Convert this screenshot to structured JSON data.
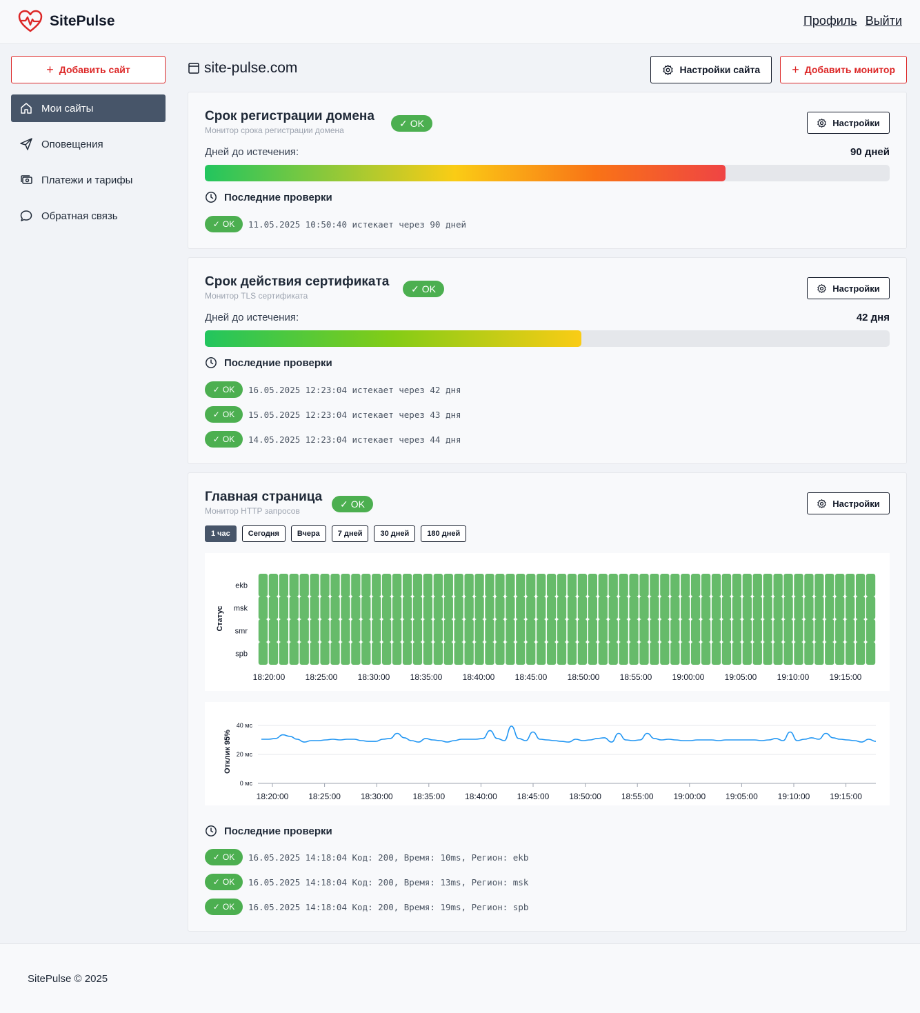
{
  "app": {
    "name": "SitePulse",
    "profile_link": "Профиль",
    "logout_link": "Выйти"
  },
  "colors": {
    "accent": "#dc2626",
    "ok": "#4caf50",
    "nav_active": "#475569",
    "line": "#2196f3"
  },
  "sidebar": {
    "add_site": "Добавить сайт",
    "items": [
      {
        "label": "Мои сайты",
        "icon": "home-icon",
        "active": true
      },
      {
        "label": "Оповещения",
        "icon": "send-icon"
      },
      {
        "label": "Платежи и тарифы",
        "icon": "payments-icon"
      },
      {
        "label": "Обратная связь",
        "icon": "chat-icon"
      }
    ]
  },
  "site": {
    "title": "site-pulse.com",
    "settings_btn": "Настройки сайта",
    "add_monitor_btn": "Добавить монитор"
  },
  "common": {
    "settings": "Настройки",
    "ok": "OK",
    "days_left": "Дней до истечения:",
    "recent_checks": "Последние проверки"
  },
  "domain_monitor": {
    "title": "Срок регистрации домена",
    "subtitle": "Монитор срока регистрации домена",
    "days_value": "90 дней",
    "progress": 0.76,
    "checks": [
      {
        "status": "OK",
        "text": "11.05.2025 10:50:40 истекает через 90 дней"
      }
    ]
  },
  "cert_monitor": {
    "title": "Срок действия сертификата",
    "subtitle": "Монитор TLS сертификата",
    "days_value": "42 дня",
    "progress": 0.55,
    "checks": [
      {
        "status": "OK",
        "text": "16.05.2025 12:23:04 истекает через 42 дня"
      },
      {
        "status": "OK",
        "text": "15.05.2025 12:23:04 истекает через 43 дня"
      },
      {
        "status": "OK",
        "text": "14.05.2025 12:23:04 истекает через 44 дня"
      }
    ]
  },
  "http_monitor": {
    "title": "Главная страница",
    "subtitle": "Монитор HTTP запросов",
    "ranges": [
      "1 час",
      "Сегодня",
      "Вчера",
      "7 дней",
      "30 дней",
      "180 дней"
    ],
    "active_range": 0,
    "checks": [
      {
        "status": "OK",
        "text": "16.05.2025 14:18:04 Код: 200, Время: 10ms, Регион: ekb"
      },
      {
        "status": "OK",
        "text": "16.05.2025 14:18:04 Код: 200, Время: 13ms, Регион: msk"
      },
      {
        "status": "OK",
        "text": "16.05.2025 14:18:04 Код: 200, Время: 19ms, Регион: spb"
      }
    ]
  },
  "chart_data": [
    {
      "type": "heatmap",
      "ylabel": "Статус",
      "regions": [
        "ekb",
        "msk",
        "smr",
        "spb"
      ],
      "x_ticks": [
        "18:20:00",
        "18:25:00",
        "18:30:00",
        "18:35:00",
        "18:40:00",
        "18:45:00",
        "18:50:00",
        "18:55:00",
        "19:00:00",
        "19:05:00",
        "19:10:00",
        "19:15:00"
      ],
      "columns": 60,
      "status": "up",
      "cell_color": "#66bb6a"
    },
    {
      "type": "line",
      "ylabel": "Отклик 95%",
      "y_ticks": [
        "0 мс",
        "20 мс",
        "40 мс"
      ],
      "ylim": [
        0,
        40
      ],
      "x_ticks": [
        "18:20:00",
        "18:25:00",
        "18:30:00",
        "18:35:00",
        "18:40:00",
        "18:45:00",
        "18:50:00",
        "18:55:00",
        "19:00:00",
        "19:05:00",
        "19:10:00",
        "19:15:00"
      ],
      "series": [
        {
          "values": [
            30.5,
            30.5,
            31,
            33.5,
            32.5,
            30.5,
            28.5,
            29.5,
            29.5,
            30,
            30.5,
            30,
            30.5,
            30.5,
            29.5,
            29,
            29,
            30.5,
            31,
            34.5,
            31.5,
            29.5,
            28.5,
            31,
            30,
            29.5,
            28.5,
            29.5,
            30.5,
            30.5,
            30.5,
            31,
            36.5,
            31,
            29.5,
            39.5,
            31,
            29.5,
            35.5,
            30.5,
            30,
            29.5,
            29,
            28.5,
            30.5,
            29.5,
            30,
            31,
            31.5,
            28.5,
            34.5,
            30,
            29.5,
            30,
            34.5,
            31,
            30,
            30.5,
            30,
            29.5,
            29.5,
            30,
            30,
            30,
            29.5,
            30,
            30,
            30,
            30,
            30,
            29.5,
            30,
            31,
            29.5,
            35.5,
            29.5,
            30.5,
            31.5,
            30.5,
            34.5,
            31.5,
            30.5,
            30,
            29.5,
            28.5,
            30.5,
            29
          ]
        }
      ]
    }
  ],
  "footer": {
    "text": "SitePulse © 2025"
  }
}
